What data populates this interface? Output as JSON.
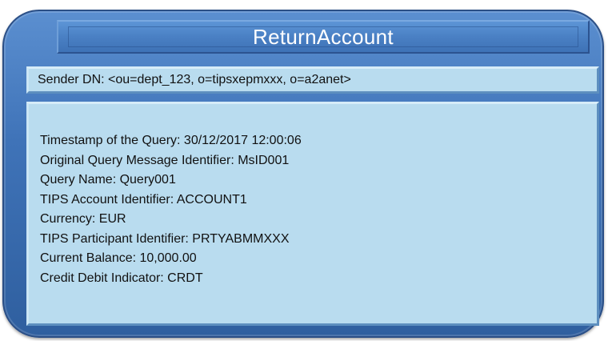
{
  "title": "ReturnAccount",
  "sender": "Sender DN: <ou=dept_123, o=tipsxepmxxx, o=a2anet>",
  "details": [
    "Timestamp of the Query: 30/12/2017 12:00:06",
    "Original Query Message Identifier: MsID001",
    "Query Name: Query001",
    "TIPS Account Identifier: ACCOUNT1",
    "Currency: EUR",
    "TIPS Participant Identifier: PRTYABMMXXX",
    "Current Balance: 10,000.00",
    "Credit Debit Indicator: CRDT"
  ]
}
